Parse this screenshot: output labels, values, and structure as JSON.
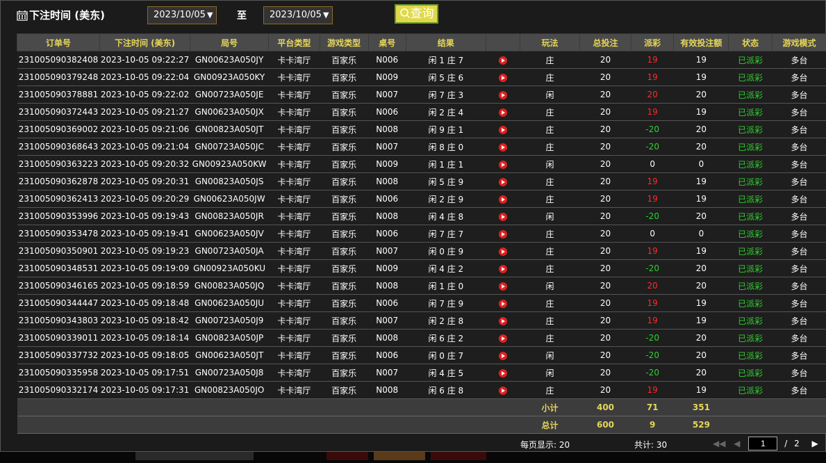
{
  "header": {
    "title": "下注时间 (美东)",
    "date_from": "2023/10/05",
    "date_to": "2023/10/05",
    "to_label": "至",
    "query_label": "查询"
  },
  "table": {
    "columns": [
      "订单号",
      "下注时间 (美东)",
      "局号",
      "平台类型",
      "游戏类型",
      "桌号",
      "结果",
      "",
      "玩法",
      "总投注",
      "派彩",
      "有效投注额",
      "状态",
      "游戏模式"
    ],
    "rows": [
      {
        "order": "231005090382408",
        "time": "2023-10-05 09:22:27",
        "round": "GN00623A050JY",
        "platform": "卡卡湾厅",
        "game": "百家乐",
        "table": "N006",
        "result": "闲 1 庄 7",
        "play": "庄",
        "bet": "20",
        "payout": "19",
        "payout_color": "red",
        "valid": "19",
        "status": "已派彩",
        "mode": "多台"
      },
      {
        "order": "231005090379248",
        "time": "2023-10-05 09:22:04",
        "round": "GN00923A050KY",
        "platform": "卡卡湾厅",
        "game": "百家乐",
        "table": "N009",
        "result": "闲 5 庄 6",
        "play": "庄",
        "bet": "20",
        "payout": "19",
        "payout_color": "red",
        "valid": "19",
        "status": "已派彩",
        "mode": "多台"
      },
      {
        "order": "231005090378881",
        "time": "2023-10-05 09:22:02",
        "round": "GN00723A050JE",
        "platform": "卡卡湾厅",
        "game": "百家乐",
        "table": "N007",
        "result": "闲 7 庄 3",
        "play": "闲",
        "bet": "20",
        "payout": "20",
        "payout_color": "red",
        "valid": "20",
        "status": "已派彩",
        "mode": "多台"
      },
      {
        "order": "231005090372443",
        "time": "2023-10-05 09:21:27",
        "round": "GN00623A050JX",
        "platform": "卡卡湾厅",
        "game": "百家乐",
        "table": "N006",
        "result": "闲 2 庄 4",
        "play": "庄",
        "bet": "20",
        "payout": "19",
        "payout_color": "red",
        "valid": "19",
        "status": "已派彩",
        "mode": "多台"
      },
      {
        "order": "231005090369002",
        "time": "2023-10-05 09:21:06",
        "round": "GN00823A050JT",
        "platform": "卡卡湾厅",
        "game": "百家乐",
        "table": "N008",
        "result": "闲 9 庄 1",
        "play": "庄",
        "bet": "20",
        "payout": "-20",
        "payout_color": "green",
        "valid": "20",
        "status": "已派彩",
        "mode": "多台"
      },
      {
        "order": "231005090368643",
        "time": "2023-10-05 09:21:04",
        "round": "GN00723A050JC",
        "platform": "卡卡湾厅",
        "game": "百家乐",
        "table": "N007",
        "result": "闲 8 庄 0",
        "play": "庄",
        "bet": "20",
        "payout": "-20",
        "payout_color": "green",
        "valid": "20",
        "status": "已派彩",
        "mode": "多台"
      },
      {
        "order": "231005090363223",
        "time": "2023-10-05 09:20:32",
        "round": "GN00923A050KW",
        "platform": "卡卡湾厅",
        "game": "百家乐",
        "table": "N009",
        "result": "闲 1 庄 1",
        "play": "闲",
        "bet": "20",
        "payout": "0",
        "payout_color": "white",
        "valid": "0",
        "status": "已派彩",
        "mode": "多台"
      },
      {
        "order": "231005090362878",
        "time": "2023-10-05 09:20:31",
        "round": "GN00823A050JS",
        "platform": "卡卡湾厅",
        "game": "百家乐",
        "table": "N008",
        "result": "闲 5 庄 9",
        "play": "庄",
        "bet": "20",
        "payout": "19",
        "payout_color": "red",
        "valid": "19",
        "status": "已派彩",
        "mode": "多台"
      },
      {
        "order": "231005090362413",
        "time": "2023-10-05 09:20:29",
        "round": "GN00623A050JW",
        "platform": "卡卡湾厅",
        "game": "百家乐",
        "table": "N006",
        "result": "闲 2 庄 9",
        "play": "庄",
        "bet": "20",
        "payout": "19",
        "payout_color": "red",
        "valid": "19",
        "status": "已派彩",
        "mode": "多台"
      },
      {
        "order": "231005090353996",
        "time": "2023-10-05 09:19:43",
        "round": "GN00823A050JR",
        "platform": "卡卡湾厅",
        "game": "百家乐",
        "table": "N008",
        "result": "闲 4 庄 8",
        "play": "闲",
        "bet": "20",
        "payout": "-20",
        "payout_color": "green",
        "valid": "20",
        "status": "已派彩",
        "mode": "多台"
      },
      {
        "order": "231005090353478",
        "time": "2023-10-05 09:19:41",
        "round": "GN00623A050JV",
        "platform": "卡卡湾厅",
        "game": "百家乐",
        "table": "N006",
        "result": "闲 7 庄 7",
        "play": "庄",
        "bet": "20",
        "payout": "0",
        "payout_color": "white",
        "valid": "0",
        "status": "已派彩",
        "mode": "多台"
      },
      {
        "order": "231005090350901",
        "time": "2023-10-05 09:19:23",
        "round": "GN00723A050JA",
        "platform": "卡卡湾厅",
        "game": "百家乐",
        "table": "N007",
        "result": "闲 0 庄 9",
        "play": "庄",
        "bet": "20",
        "payout": "19",
        "payout_color": "red",
        "valid": "19",
        "status": "已派彩",
        "mode": "多台"
      },
      {
        "order": "231005090348531",
        "time": "2023-10-05 09:19:09",
        "round": "GN00923A050KU",
        "platform": "卡卡湾厅",
        "game": "百家乐",
        "table": "N009",
        "result": "闲 4 庄 2",
        "play": "庄",
        "bet": "20",
        "payout": "-20",
        "payout_color": "green",
        "valid": "20",
        "status": "已派彩",
        "mode": "多台"
      },
      {
        "order": "231005090346165",
        "time": "2023-10-05 09:18:59",
        "round": "GN00823A050JQ",
        "platform": "卡卡湾厅",
        "game": "百家乐",
        "table": "N008",
        "result": "闲 1 庄 0",
        "play": "闲",
        "bet": "20",
        "payout": "20",
        "payout_color": "red",
        "valid": "20",
        "status": "已派彩",
        "mode": "多台"
      },
      {
        "order": "231005090344447",
        "time": "2023-10-05 09:18:48",
        "round": "GN00623A050JU",
        "platform": "卡卡湾厅",
        "game": "百家乐",
        "table": "N006",
        "result": "闲 7 庄 9",
        "play": "庄",
        "bet": "20",
        "payout": "19",
        "payout_color": "red",
        "valid": "19",
        "status": "已派彩",
        "mode": "多台"
      },
      {
        "order": "231005090343803",
        "time": "2023-10-05 09:18:42",
        "round": "GN00723A050J9",
        "platform": "卡卡湾厅",
        "game": "百家乐",
        "table": "N007",
        "result": "闲 2 庄 8",
        "play": "庄",
        "bet": "20",
        "payout": "19",
        "payout_color": "red",
        "valid": "19",
        "status": "已派彩",
        "mode": "多台"
      },
      {
        "order": "231005090339011",
        "time": "2023-10-05 09:18:14",
        "round": "GN00823A050JP",
        "platform": "卡卡湾厅",
        "game": "百家乐",
        "table": "N008",
        "result": "闲 6 庄 2",
        "play": "庄",
        "bet": "20",
        "payout": "-20",
        "payout_color": "green",
        "valid": "20",
        "status": "已派彩",
        "mode": "多台"
      },
      {
        "order": "231005090337732",
        "time": "2023-10-05 09:18:05",
        "round": "GN00623A050JT",
        "platform": "卡卡湾厅",
        "game": "百家乐",
        "table": "N006",
        "result": "闲 0 庄 7",
        "play": "闲",
        "bet": "20",
        "payout": "-20",
        "payout_color": "green",
        "valid": "20",
        "status": "已派彩",
        "mode": "多台"
      },
      {
        "order": "231005090335958",
        "time": "2023-10-05 09:17:51",
        "round": "GN00723A050J8",
        "platform": "卡卡湾厅",
        "game": "百家乐",
        "table": "N007",
        "result": "闲 4 庄 5",
        "play": "闲",
        "bet": "20",
        "payout": "-20",
        "payout_color": "green",
        "valid": "20",
        "status": "已派彩",
        "mode": "多台"
      },
      {
        "order": "231005090332174",
        "time": "2023-10-05 09:17:31",
        "round": "GN00823A050JO",
        "platform": "卡卡湾厅",
        "game": "百家乐",
        "table": "N008",
        "result": "闲 6 庄 8",
        "play": "庄",
        "bet": "20",
        "payout": "19",
        "payout_color": "red",
        "valid": "19",
        "status": "已派彩",
        "mode": "多台"
      }
    ],
    "subtotal": {
      "label": "小计",
      "bet": "400",
      "payout": "71",
      "valid": "351"
    },
    "total": {
      "label": "总计",
      "bet": "600",
      "payout": "9",
      "valid": "529"
    }
  },
  "footer": {
    "per_page": "每页显示: 20",
    "total": "共计: 30",
    "page_current": "1",
    "page_sep": "/",
    "page_total": "2"
  },
  "colors": {
    "header_text": "#e6d65a",
    "payout_win": "#ff2a2a",
    "payout_loss": "#2fd12f",
    "status": "#2fd12f",
    "query_button": "#e0d84a",
    "play_icon": "#e02020"
  }
}
